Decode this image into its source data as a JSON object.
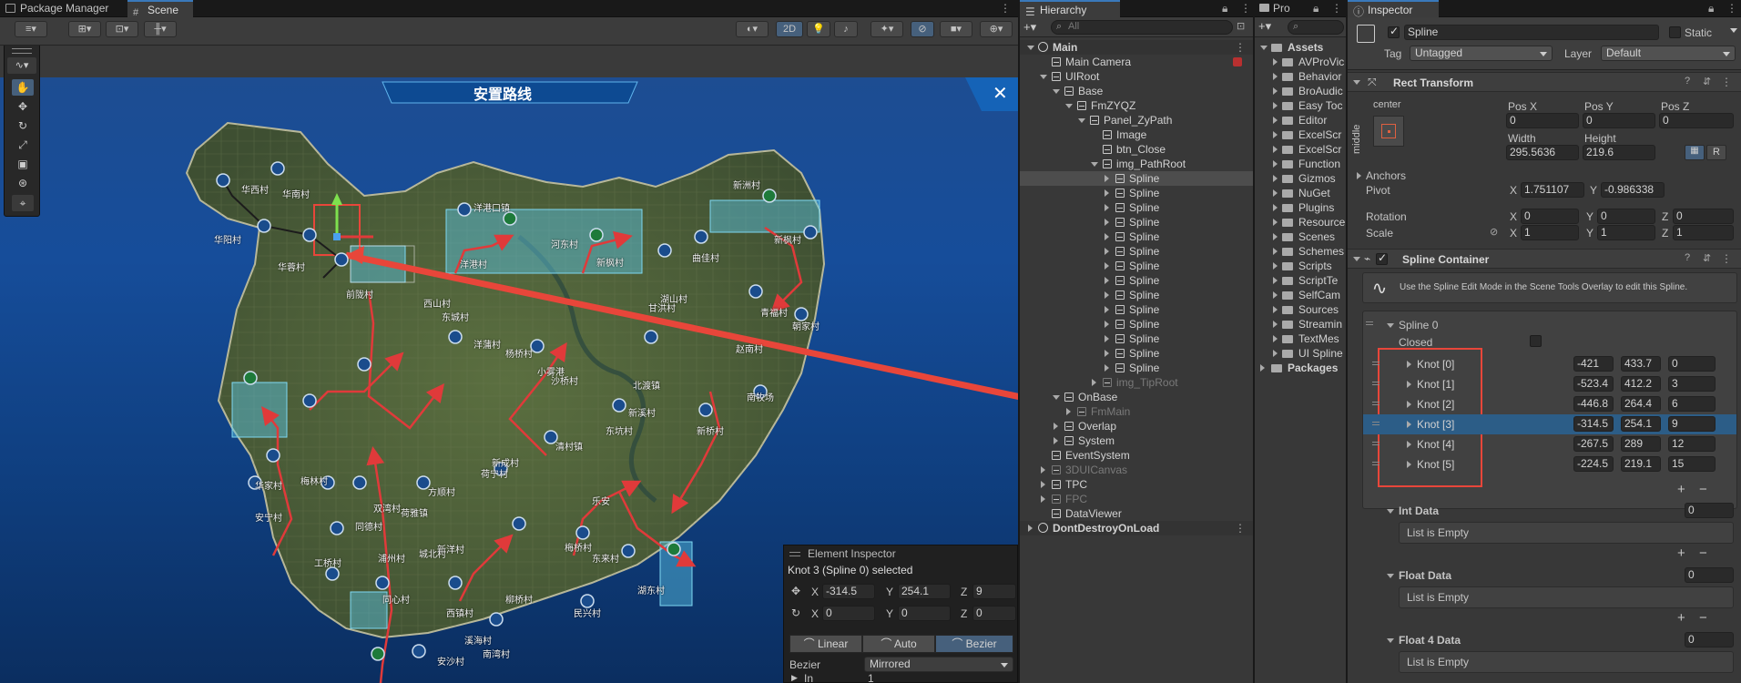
{
  "tabs": {
    "package_manager": "Package Manager",
    "scene": "Scene",
    "hierarchy": "Hierarchy",
    "project": "Pro",
    "inspector": "Inspector"
  },
  "scene_toolbar": {
    "mode_2d": "2D"
  },
  "scene_view": {
    "map_title": "安置路线",
    "close_symbol": "✕",
    "village_labels": [
      {
        "name": "华西村"
      },
      {
        "name": "华南村"
      },
      {
        "name": "华阳村"
      },
      {
        "name": "华蓉村"
      },
      {
        "name": "前陇村"
      },
      {
        "name": "洋港口镇"
      },
      {
        "name": "洋港村"
      },
      {
        "name": "西山村"
      },
      {
        "name": "东城村"
      },
      {
        "name": "河东村"
      },
      {
        "name": "新枫村"
      },
      {
        "name": "新洲村"
      },
      {
        "name": "曲佳村"
      },
      {
        "name": "新枫村"
      },
      {
        "name": "青福村"
      },
      {
        "name": "朝家村"
      },
      {
        "name": "赵南村"
      },
      {
        "name": "甘洪村"
      },
      {
        "name": "湖山村"
      },
      {
        "name": "洋蒲村"
      },
      {
        "name": "小雾港"
      },
      {
        "name": "杨桥村"
      },
      {
        "name": "沙桥村"
      },
      {
        "name": "新溪村"
      },
      {
        "name": "北渡镇"
      },
      {
        "name": "南牧场"
      },
      {
        "name": "新桥村"
      },
      {
        "name": "东坑村"
      },
      {
        "name": "清村镇"
      },
      {
        "name": "新成村"
      },
      {
        "name": "荷宁村"
      },
      {
        "name": "方顺村"
      },
      {
        "name": "双湾村"
      },
      {
        "name": "荷雅镇"
      },
      {
        "name": "浦州村"
      },
      {
        "name": "新洋村"
      },
      {
        "name": "华家村"
      },
      {
        "name": "梅林村"
      },
      {
        "name": "乐安"
      },
      {
        "name": "同德村"
      },
      {
        "name": "梅桥村"
      },
      {
        "name": "城北村"
      },
      {
        "name": "东来村"
      },
      {
        "name": "柳桥村"
      },
      {
        "name": "湖东村"
      },
      {
        "name": "工桥村"
      },
      {
        "name": "同心村"
      },
      {
        "name": "安宁村"
      },
      {
        "name": "西镇村"
      },
      {
        "name": "溪海村"
      },
      {
        "name": "南湾村"
      },
      {
        "name": "民兴村"
      },
      {
        "name": "安沙村"
      }
    ]
  },
  "element_inspector": {
    "title": "Element Inspector",
    "selected_prefix": "Knot 3 (",
    "selected_spline": "Spline 0",
    "selected_suffix": ") selected",
    "pos": {
      "x_label": "X",
      "x": "-314.5",
      "y_label": "Y",
      "y": "254.1",
      "z_label": "Z",
      "z": "9"
    },
    "rot": {
      "x_label": "X",
      "x": "0",
      "y_label": "Y",
      "y": "0",
      "z_label": "Z",
      "z": "0"
    },
    "modes": [
      "Linear",
      "Auto",
      "Bezier"
    ],
    "active_mode": "Bezier",
    "bezier_label": "Bezier",
    "bezier_value": "Mirrored",
    "in_label": "In",
    "in_value": "1"
  },
  "hierarchy": {
    "search_placeholder": "All",
    "items": [
      {
        "label": "Main",
        "depth": 0,
        "expanded": true,
        "icon": "unity-icon",
        "style": "scene"
      },
      {
        "label": "Main Camera",
        "depth": 1,
        "icon": "cube-icon"
      },
      {
        "label": "UIRoot",
        "depth": 1,
        "expanded": true,
        "icon": "cube-icon"
      },
      {
        "label": "Base",
        "depth": 2,
        "expanded": true,
        "icon": "cube-icon"
      },
      {
        "label": "FmZYQZ",
        "depth": 3,
        "expanded": true,
        "icon": "cube-icon"
      },
      {
        "label": "Panel_ZyPath",
        "depth": 4,
        "expanded": true,
        "icon": "cube-icon"
      },
      {
        "label": "Image",
        "depth": 5,
        "icon": "cube-icon"
      },
      {
        "label": "btn_Close",
        "depth": 5,
        "icon": "cube-icon"
      },
      {
        "label": "img_PathRoot",
        "depth": 5,
        "expanded": true,
        "icon": "cube-icon"
      },
      {
        "label": "Spline",
        "depth": 6,
        "collapsed": true,
        "icon": "cube-icon",
        "selected": true
      },
      {
        "label": "Spline",
        "depth": 6,
        "collapsed": true,
        "icon": "cube-icon"
      },
      {
        "label": "Spline",
        "depth": 6,
        "collapsed": true,
        "icon": "cube-icon"
      },
      {
        "label": "Spline",
        "depth": 6,
        "collapsed": true,
        "icon": "cube-icon"
      },
      {
        "label": "Spline",
        "depth": 6,
        "collapsed": true,
        "icon": "cube-icon"
      },
      {
        "label": "Spline",
        "depth": 6,
        "collapsed": true,
        "icon": "cube-icon"
      },
      {
        "label": "Spline",
        "depth": 6,
        "collapsed": true,
        "icon": "cube-icon"
      },
      {
        "label": "Spline",
        "depth": 6,
        "collapsed": true,
        "icon": "cube-icon"
      },
      {
        "label": "Spline",
        "depth": 6,
        "collapsed": true,
        "icon": "cube-icon"
      },
      {
        "label": "Spline",
        "depth": 6,
        "collapsed": true,
        "icon": "cube-icon"
      },
      {
        "label": "Spline",
        "depth": 6,
        "collapsed": true,
        "icon": "cube-icon"
      },
      {
        "label": "Spline",
        "depth": 6,
        "collapsed": true,
        "icon": "cube-icon"
      },
      {
        "label": "Spline",
        "depth": 6,
        "collapsed": true,
        "icon": "cube-icon"
      },
      {
        "label": "Spline",
        "depth": 6,
        "collapsed": true,
        "icon": "cube-icon"
      },
      {
        "label": "img_TipRoot",
        "depth": 5,
        "collapsed": true,
        "icon": "cube-icon",
        "dim": true
      },
      {
        "label": "OnBase",
        "depth": 2,
        "expanded": true,
        "icon": "cube-icon"
      },
      {
        "label": "FmMain",
        "depth": 3,
        "collapsed": true,
        "icon": "cube-icon",
        "dim": true
      },
      {
        "label": "Overlap",
        "depth": 2,
        "collapsed": true,
        "icon": "cube-icon"
      },
      {
        "label": "System",
        "depth": 2,
        "collapsed": true,
        "icon": "cube-icon"
      },
      {
        "label": "EventSystem",
        "depth": 1,
        "icon": "cube-icon"
      },
      {
        "label": "3DUICanvas",
        "depth": 1,
        "collapsed": true,
        "icon": "cube-icon",
        "dim": true
      },
      {
        "label": "TPC",
        "depth": 1,
        "collapsed": true,
        "icon": "cube-icon"
      },
      {
        "label": "FPC",
        "depth": 1,
        "collapsed": true,
        "icon": "cube-icon",
        "dim": true
      },
      {
        "label": "DataViewer",
        "depth": 1,
        "icon": "cube-icon"
      },
      {
        "label": "DontDestroyOnLoad",
        "depth": 0,
        "collapsed": true,
        "icon": "unity-icon",
        "style": "scene"
      }
    ]
  },
  "project": {
    "root": "Assets",
    "folders": [
      "AVProVic",
      "Behavior",
      "BroAudic",
      "Easy Toc",
      "Editor",
      "ExcelScr",
      "ExcelScr",
      "Function",
      "Gizmos",
      "NuGet",
      "Plugins",
      "Resource",
      "Scenes",
      "Schemes",
      "Scripts",
      "ScriptTe",
      "SelfCam",
      "Sources",
      "Streamin",
      "TextMes",
      "UI Spline"
    ],
    "packages": "Packages"
  },
  "inspector": {
    "object_name": "Spline",
    "static_label": "Static",
    "tag_label": "Tag",
    "tag_value": "Untagged",
    "layer_label": "Layer",
    "layer_value": "Default",
    "rect_transform": {
      "title": "Rect Transform",
      "anchor_h": "center",
      "anchor_v": "middle",
      "pos_x_label": "Pos X",
      "pos_x": "0",
      "pos_y_label": "Pos Y",
      "pos_y": "0",
      "pos_z_label": "Pos Z",
      "pos_z": "0",
      "width_label": "Width",
      "width": "295.5636",
      "height_label": "Height",
      "height": "219.6",
      "r_button": "R",
      "anchors_label": "Anchors",
      "pivot_label": "Pivot",
      "pivot_x_label": "X",
      "pivot_x": "1.751107",
      "pivot_y_label": "Y",
      "pivot_y": "-0.986338",
      "rotation_label": "Rotation",
      "rot_x": "0",
      "rot_y": "0",
      "rot_z": "0",
      "scale_label": "Scale",
      "scale_x": "1",
      "scale_y": "1",
      "scale_z": "1",
      "x_label": "X",
      "y_label": "Y",
      "z_label": "Z"
    },
    "spline_container": {
      "title": "Spline Container",
      "help": "Use the Spline Edit Mode in the Scene Tools Overlay to edit this Spline.",
      "spline_label": "Spline 0",
      "closed_label": "Closed",
      "knots": [
        {
          "label": "Knot [0]",
          "x": "-421",
          "y": "433.7",
          "z": "0"
        },
        {
          "label": "Knot [1]",
          "x": "-523.4",
          "y": "412.2",
          "z": "3"
        },
        {
          "label": "Knot [2]",
          "x": "-446.8",
          "y": "264.4",
          "z": "6"
        },
        {
          "label": "Knot [3]",
          "x": "-314.5",
          "y": "254.1",
          "z": "9",
          "selected": true
        },
        {
          "label": "Knot [4]",
          "x": "-267.5",
          "y": "289",
          "z": "12"
        },
        {
          "label": "Knot [5]",
          "x": "-224.5",
          "y": "219.1",
          "z": "15"
        }
      ],
      "plus": "+",
      "minus": "−"
    },
    "int_data": {
      "label": "Int Data",
      "count": "0",
      "empty": "List is Empty"
    },
    "float_data": {
      "label": "Float Data",
      "count": "0",
      "empty": "List is Empty"
    },
    "float4_data": {
      "label": "Float 4 Data",
      "count": "0",
      "empty": "List is Empty"
    }
  },
  "colors": {
    "accent_blue": "#46607c",
    "annotation_red": "#e8463a",
    "route_red": "#e03a3a",
    "zone_cyan": "#5ac8e8"
  }
}
